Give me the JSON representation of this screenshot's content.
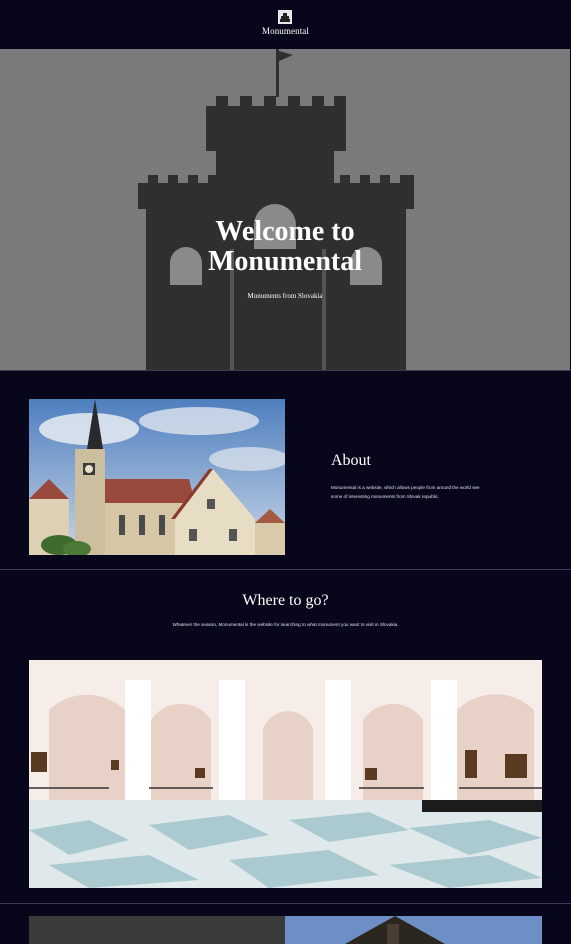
{
  "header": {
    "brand": "Monumental",
    "logo_icon": "monument-logo-icon"
  },
  "hero": {
    "title_line1": "Welcome to",
    "title_line2": "Monumental",
    "subtitle": "Monuments from Slovakia"
  },
  "about": {
    "title": "About",
    "text": "Monumental is a website, which allows people from around the world see some of interesting monuments from Slovak republic."
  },
  "where": {
    "title": "Where to go?",
    "text": "Whatever the season, Monumental is the website for searching to what monument you want to visit in Slovakia."
  },
  "colors": {
    "background": "#07061a",
    "hero_bg": "#7a7a7a",
    "castle": "#2f2f2f"
  }
}
